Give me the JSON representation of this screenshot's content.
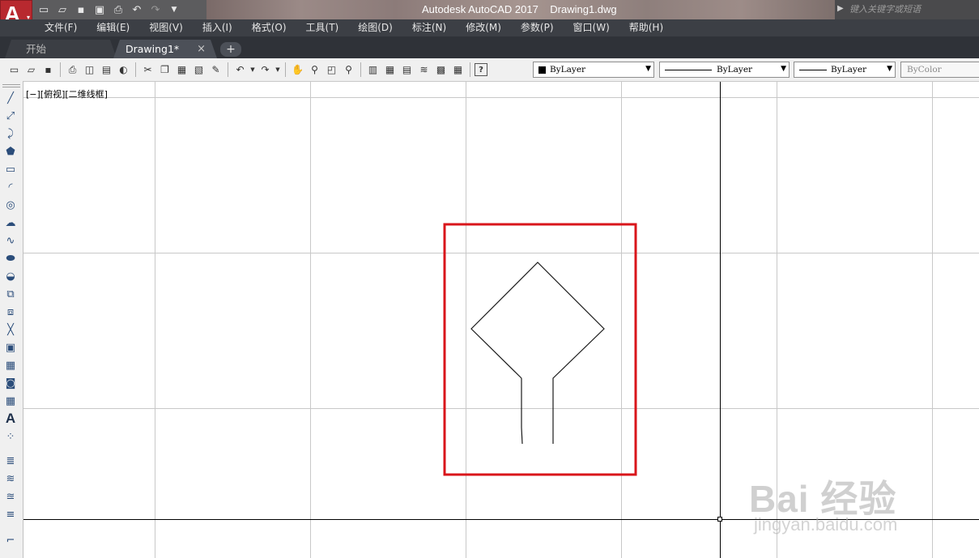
{
  "app": {
    "logo_letter": "A",
    "title": "Autodesk AutoCAD 2017    Drawing1.dwg",
    "search_placeholder": "键入关键字或短语"
  },
  "quick_access": [
    "new-icon",
    "open-icon",
    "save-icon",
    "saveas-icon",
    "plot-icon",
    "undo-icon",
    "redo-icon",
    "customize-icon"
  ],
  "menu": [
    "文件(F)",
    "编辑(E)",
    "视图(V)",
    "插入(I)",
    "格式(O)",
    "工具(T)",
    "绘图(D)",
    "标注(N)",
    "修改(M)",
    "参数(P)",
    "窗口(W)",
    "帮助(H)"
  ],
  "tabs": {
    "start": "开始",
    "drawing": "Drawing1*",
    "close_glyph": "×",
    "add_glyph": "+"
  },
  "properties": {
    "layer": "ByLayer",
    "linetype": "ByLayer",
    "lineweight": "ByLayer",
    "color": "ByColor"
  },
  "viewport_label": "[−][俯视][二维线框]",
  "watermark": {
    "brand": "Bai 经验",
    "url": "jingyan.baidu.com"
  },
  "colors": {
    "highlight_box": "#d9161b",
    "logo": "#b8292f",
    "menubar": "#3c3f45"
  }
}
